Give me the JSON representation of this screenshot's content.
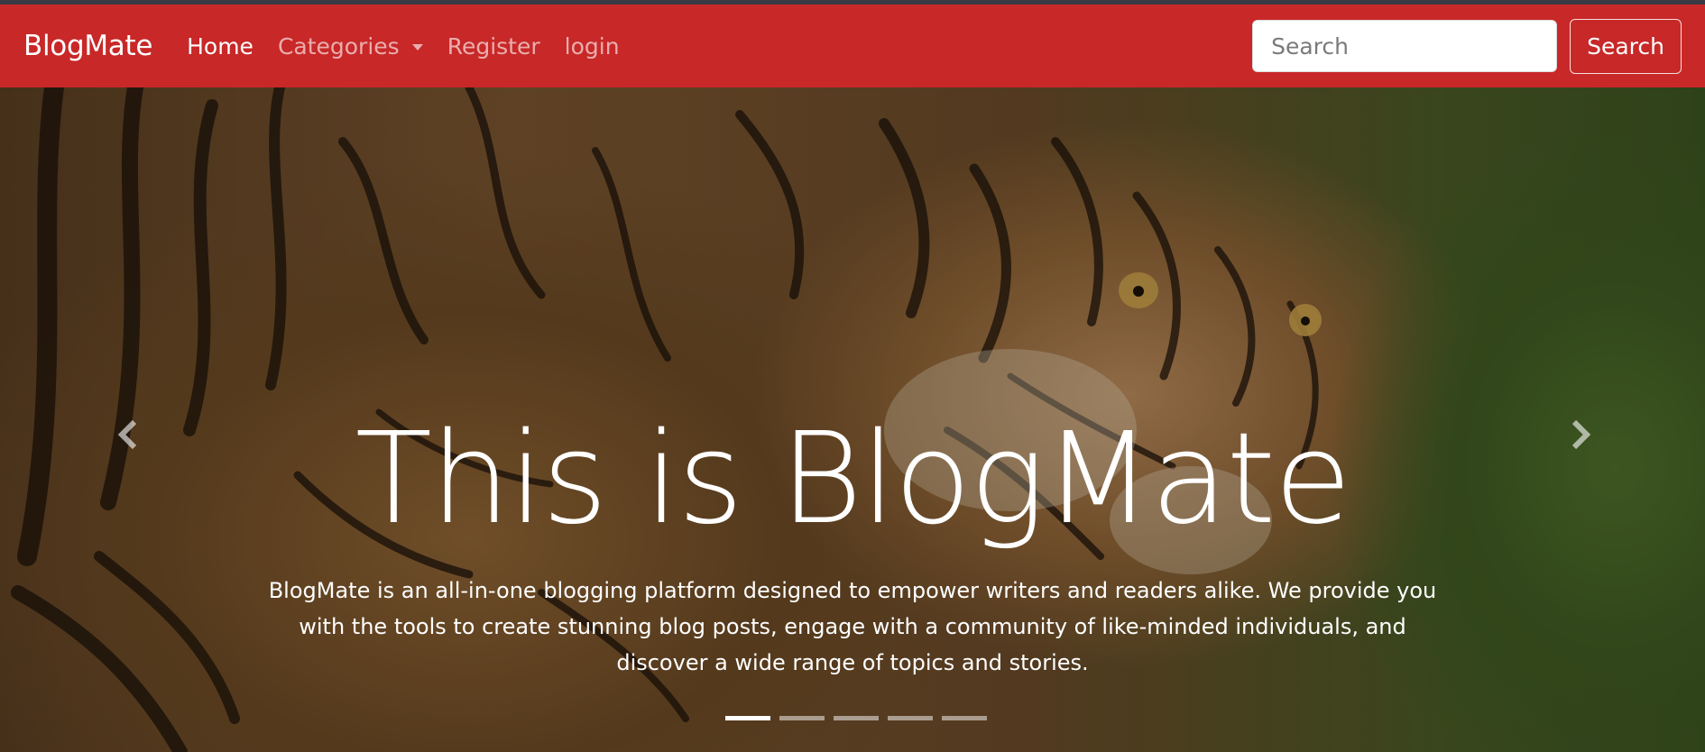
{
  "navbar": {
    "brand": "BlogMate",
    "links": [
      {
        "label": "Home",
        "active": true
      },
      {
        "label": "Categories",
        "dropdown": true
      },
      {
        "label": "Register"
      },
      {
        "label": "login"
      }
    ],
    "search": {
      "placeholder": "Search",
      "value": "",
      "button_label": "Search"
    },
    "color": "#c82828"
  },
  "hero": {
    "title": "This is BlogMate",
    "description": "BlogMate is an all-in-one blogging platform designed to empower writers and readers alike. We provide you with the tools to create stunning blog posts, engage with a community of like-minded individuals, and discover a wide range of topics and stories.",
    "prev_icon": "chevron-left-icon",
    "next_icon": "chevron-right-icon",
    "slides_count": 5,
    "active_slide": 1,
    "background": "tiger-photo"
  }
}
